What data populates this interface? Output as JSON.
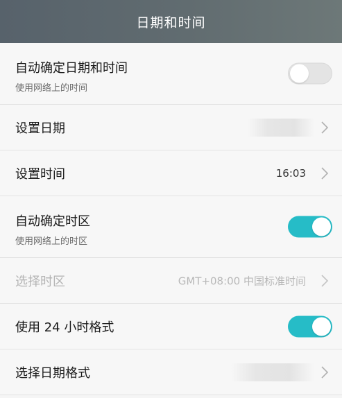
{
  "header": {
    "title": "日期和时间",
    "background": "#5c676e"
  },
  "colors": {
    "accent": "#26bcc7",
    "toggle_off": "#e4e4e4",
    "disabled_text": "#b4b4b4"
  },
  "rows": [
    {
      "label": "自动确定日期和时间",
      "sub": "使用网络上的时间",
      "control": "toggle",
      "state": "off"
    },
    {
      "label": "设置日期",
      "value": "",
      "control": "chevron",
      "value_obscured": true
    },
    {
      "label": "设置时间",
      "value": "16:03",
      "control": "chevron"
    },
    {
      "label": "自动确定时区",
      "sub": "使用网络上的时区",
      "control": "toggle",
      "state": "on"
    },
    {
      "label": "选择时区",
      "value": "GMT+08:00 中国标准时间",
      "control": "chevron",
      "disabled": true
    },
    {
      "label": "使用 24 小时格式",
      "control": "toggle",
      "state": "on"
    },
    {
      "label": "选择日期格式",
      "value": "",
      "control": "chevron",
      "value_obscured": true
    }
  ],
  "icons": {
    "chevron": "chevron-right-icon"
  }
}
